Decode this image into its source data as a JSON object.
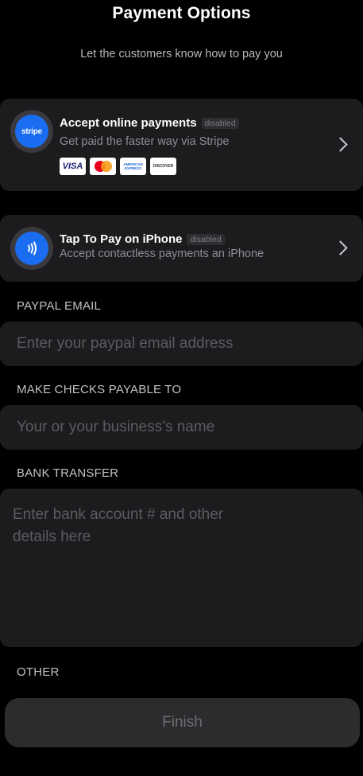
{
  "header": {
    "title": "Payment Options",
    "subtitle": "Let the customers know how to pay you"
  },
  "stripe_card": {
    "icon_text": "stripe",
    "title": "Accept online payments",
    "status": "disabled",
    "description": "Get paid the faster way via Stripe",
    "logos": {
      "visa": "VISA",
      "amex": "AMERICAN EXPRESS",
      "discover": "DISCOVER"
    }
  },
  "tap_card": {
    "title": "Tap To Pay on iPhone",
    "status": "disabled",
    "description": "Accept contactless payments an iPhone"
  },
  "paypal": {
    "label": "PAYPAL EMAIL",
    "placeholder": "Enter your paypal email address",
    "value": ""
  },
  "checks": {
    "label": "MAKE CHECKS PAYABLE TO",
    "placeholder": "Your or your business’s name",
    "value": ""
  },
  "bank": {
    "label": "BANK TRANSFER",
    "placeholder": "Enter bank account # and other\ndetails here",
    "value": ""
  },
  "other": {
    "label": "OTHER"
  },
  "footer": {
    "finish_label": "Finish"
  },
  "colors": {
    "background": "#000000",
    "card": "#1c1c1e",
    "accent_blue": "#1a6cf0",
    "secondary_text": "#8e8e93"
  }
}
